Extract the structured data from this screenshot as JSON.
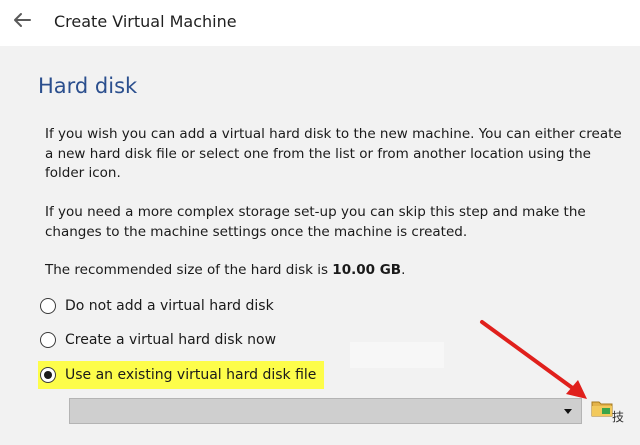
{
  "window": {
    "title": "Create Virtual Machine"
  },
  "page": {
    "heading": "Hard disk",
    "paragraph1": "If you wish you can add a virtual hard disk to the new machine. You can either create a new hard disk file or select one from the list or from another location using the folder icon.",
    "paragraph2": "If you need a more complex storage set-up you can skip this step and make the changes to the machine settings once the machine is created.",
    "recommend_prefix": "The recommended size of the hard disk is ",
    "recommend_size": "10.00 GB",
    "recommend_suffix": "."
  },
  "options": [
    {
      "label": "Do not add a virtual hard disk",
      "selected": false
    },
    {
      "label": "Create a virtual hard disk now",
      "selected": false
    },
    {
      "label": "Use an existing virtual hard disk file",
      "selected": true
    }
  ],
  "file_combo": {
    "value": ""
  },
  "colors": {
    "heading": "#2b4f8e",
    "highlight": "#fdfd4a",
    "annotation_arrow": "#e0201c"
  },
  "icons": {
    "back": "back-arrow-icon",
    "folder": "folder-icon",
    "dropdown": "chevron-down-icon"
  }
}
